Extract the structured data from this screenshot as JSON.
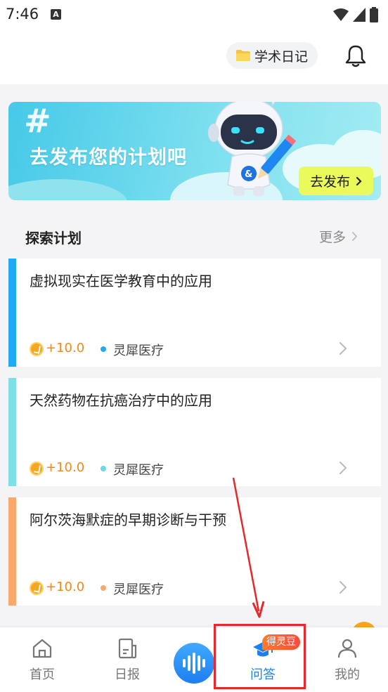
{
  "status_bar": {
    "time": "7:46",
    "notification_icon": "A"
  },
  "header": {
    "diary_label": "学术日记"
  },
  "banner": {
    "title": "去发布您的计划吧",
    "button_label": "去发布",
    "hash": "#"
  },
  "section": {
    "title": "探索计划",
    "more_label": "更多"
  },
  "cards": [
    {
      "title": "虚拟现实在医学教育中的应用",
      "points": "+10.0",
      "org": "灵犀医疗",
      "accent": "#22a9f5",
      "dot": "#22a9f5"
    },
    {
      "title": "天然药物在抗癌治疗中的应用",
      "points": "+10.0",
      "org": "灵犀医疗",
      "accent": "#7fdfe7",
      "dot": "#6ed8e2"
    },
    {
      "title": "阿尔茨海默症的早期诊断与干预",
      "points": "+10.0",
      "org": "灵犀医疗",
      "accent": "#f9a96b",
      "dot": "#f5a86b"
    }
  ],
  "nav": {
    "home": "首页",
    "daily": "日报",
    "qa": "问答",
    "qa_badge": "得灵豆",
    "me": "我的"
  },
  "colors": {
    "brand_blue": "#1f7ff2",
    "badge_orange": "#ff5a36",
    "highlight_red": "#e8272a"
  }
}
